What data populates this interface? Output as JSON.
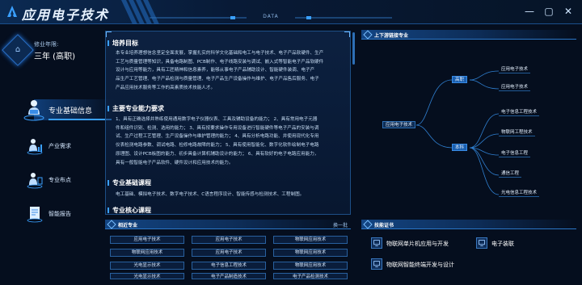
{
  "app": {
    "title": "应用电子技术",
    "tag": "DATA"
  },
  "window": {
    "minimize": "—",
    "maximize": "▢",
    "close": "✕"
  },
  "enrollment": {
    "label": "修业年限:",
    "value": "三年 (高职)"
  },
  "nav": {
    "items": [
      {
        "label": "专业基础信息",
        "icon": "student-figure-icon",
        "active": true
      },
      {
        "label": "产业需求",
        "icon": "person-chart-icon",
        "active": false
      },
      {
        "label": "专业布点",
        "icon": "person-map-icon",
        "active": false
      },
      {
        "label": "智能报告",
        "icon": "document-report-icon",
        "active": false
      }
    ]
  },
  "main": {
    "sections": [
      {
        "title": "培养目标",
        "lines": [
          "本专业培养理想信念坚定全面发展，掌握扎实的科学文化基础和电工与电子技术、电子产品软硬件、生产",
          "工艺与质量管理等知识，具备电路制图、PCB制作、电子线路安装与调试、嵌入式等智能电子产品软硬件",
          "设计与应用等能力，具有工匠精神和信息素养，能够从事电子产品辅助设计、智能硬件装调、电子产",
          "品生产工艺管理、电子产品检测与质量管理、电子产品生产设备操作与维护、电子产品售后服务、电子",
          "产品应用技术服务等工作的高素质技术技能人才。"
        ]
      },
      {
        "title": "主要专业能力要求",
        "lines": [
          "1、具有正确选择并熟练使用通用数字电子仪器仪表、工具及辅助设备的能力；  2、具有常用电子元器",
          "件和组件识别、检测、选用的能力；  3、具有按要求操作专用设备进行智能硬件等电子产品的安装与调",
          "试、生产过程工艺管理、生产设备操作与维护管理的能力；  4、具有分析电路功能、并使用现代化专用",
          "仪表检测电路参数、调试电路、检修电路故障的能力；  5、具有使用智能化、数字化软件绘制电子电路",
          "原理图、设计PCB板图的能力、初步具备计算机辅助设计的能力；  6、具有软好的电子电路应用能力，",
          "具有一般智能电子产品软件、硬件设计和应用技术的能力。"
        ]
      },
      {
        "title": "专业基础课程",
        "lines": [
          "电工基础、模拟电子技术、数字电子技术、C语言程序设计、智能传感与检测技术、工程制图。"
        ]
      },
      {
        "title": "专业核心课程",
        "lines": []
      }
    ]
  },
  "tree": {
    "title": "上下游链接专业",
    "root": "应用电子技术",
    "branches": [
      {
        "label": "高职",
        "children": [
          "应用电子技术",
          "应用电子技术"
        ]
      },
      {
        "label": "本科",
        "children": [
          "电子信息工程技术",
          "物联网工程技术",
          "电子信息工程",
          "通信工程",
          "光电信息工程技术"
        ]
      }
    ]
  },
  "majors": {
    "title": "相近专业",
    "swap": "换一批",
    "items": [
      "应用电子技术",
      "应用电子技术",
      "物联网应用技术",
      "物联网应用技术",
      "应用电子技术",
      "物联网应用技术",
      "光电显示技术",
      "电子信息工程技术",
      "物联网应用技术",
      "光电显示技术",
      "电子产品制造技术",
      "电子产品检测技术"
    ]
  },
  "certs": {
    "title": "技能证书",
    "items": [
      {
        "label": "物联网单片机应用与开发",
        "icon": "certificate-icon"
      },
      {
        "label": "电子装联",
        "icon": "certificate-icon"
      },
      {
        "label": "物联网智能终端开发与设计",
        "icon": "certificate-icon"
      }
    ]
  },
  "colors": {
    "accent": "#3aa0ff",
    "panel_border": "#1d4f86",
    "background": "#050e1e",
    "branch": "#1a5fb0"
  }
}
